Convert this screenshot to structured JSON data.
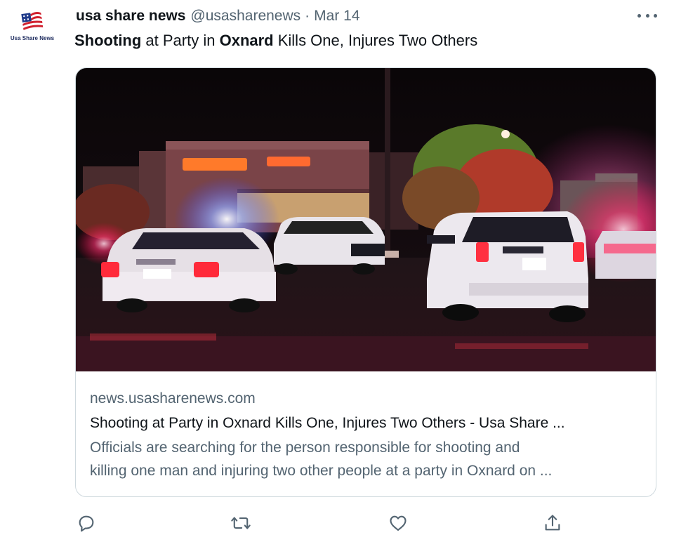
{
  "account": {
    "avatar_caption": "Usa Share News",
    "name": "usa share news",
    "handle": "@usasharenews",
    "separator": "·",
    "date": "Mar 14"
  },
  "tweet": {
    "text_parts": [
      "Shooting",
      " at Party in ",
      "Oxnard",
      " Kills One, Injures Two Others"
    ]
  },
  "card": {
    "image_icon": "police-cars-at-night-photo",
    "domain": "news.usasharenews.com",
    "title": "Shooting at Party in Oxnard Kills One, Injures Two Others - Usa Share ...",
    "description_lines": [
      "Officials are searching for the person responsible for shooting and",
      "killing one man and injuring two other people at a party in Oxnard on ..."
    ]
  },
  "actions": [
    {
      "icon": "reply-icon"
    },
    {
      "icon": "retweet-icon"
    },
    {
      "icon": "like-icon"
    },
    {
      "icon": "share-icon"
    }
  ],
  "colors": {
    "text_primary": "#0f1419",
    "text_secondary": "#536471",
    "border": "#cfd9de"
  }
}
